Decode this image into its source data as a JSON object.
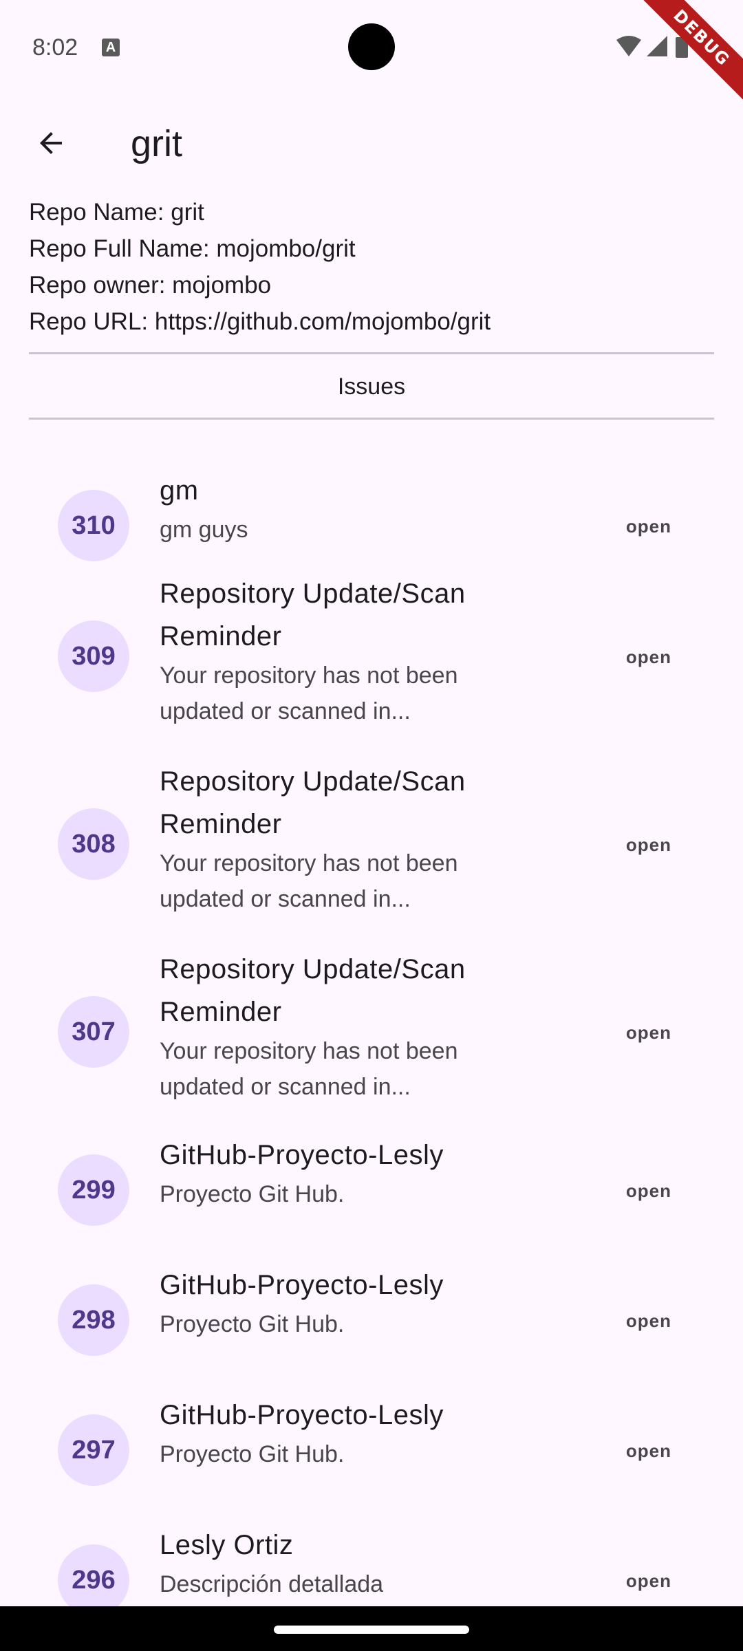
{
  "status_bar": {
    "time": "8:02",
    "notification_icon": "a-letter-icon",
    "icons": [
      "wifi-icon",
      "cellular-signal-icon",
      "battery-icon"
    ]
  },
  "debug_banner": "DEBUG",
  "app_bar": {
    "back_icon": "arrow-back-icon",
    "title": "grit"
  },
  "repo": {
    "name_line": "Repo Name: grit",
    "full_name_line": "Repo Full Name: mojombo/grit",
    "owner_line": "Repo owner: mojombo",
    "url_line": "Repo URL: https://github.com/mojombo/grit"
  },
  "tab_label": "Issues",
  "issues": [
    {
      "number": "310",
      "title": "gm",
      "subtitle": "gm guys",
      "status": "open"
    },
    {
      "number": "309",
      "title": "Repository Update/Scan Reminder",
      "subtitle": "Your repository has not been updated or scanned in...",
      "status": "open"
    },
    {
      "number": "308",
      "title": "Repository Update/Scan Reminder",
      "subtitle": "Your repository has not been updated or scanned in...",
      "status": "open"
    },
    {
      "number": "307",
      "title": "Repository Update/Scan Reminder",
      "subtitle": "Your repository has not been updated or scanned in...",
      "status": "open"
    },
    {
      "number": "299",
      "title": "GitHub-Proyecto-Lesly",
      "subtitle": "Proyecto Git Hub.",
      "status": "open"
    },
    {
      "number": "298",
      "title": "GitHub-Proyecto-Lesly",
      "subtitle": "Proyecto Git Hub.",
      "status": "open"
    },
    {
      "number": "297",
      "title": "GitHub-Proyecto-Lesly",
      "subtitle": "Proyecto Git Hub.",
      "status": "open"
    },
    {
      "number": "296",
      "title": "Lesly Ortiz",
      "subtitle": "Descripción detallada",
      "status": "open"
    }
  ],
  "colors": {
    "background": "#FEF7FF",
    "avatar_bg": "#EADDFF",
    "avatar_text": "#4F378B",
    "debug_ribbon": "#B71C1C"
  }
}
